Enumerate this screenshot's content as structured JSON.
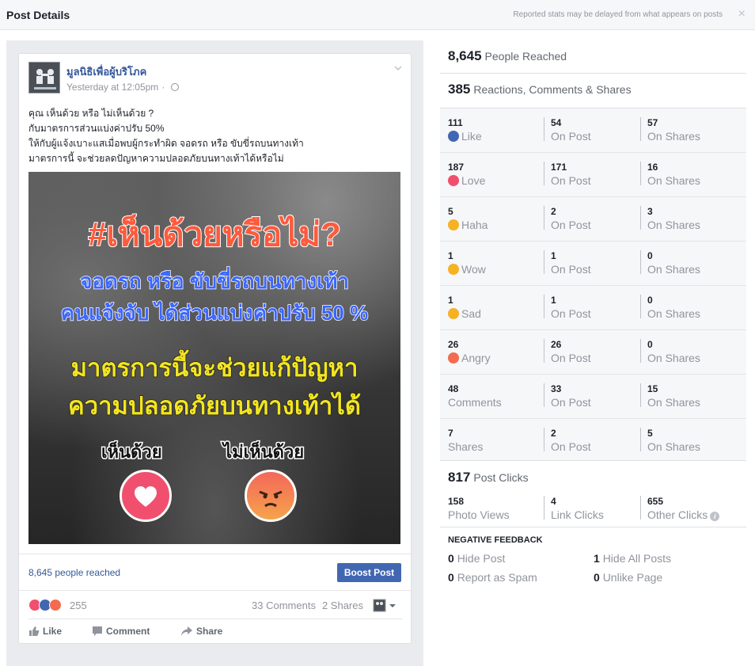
{
  "header": {
    "title": "Post Details",
    "note": "Reported stats may be delayed from what appears on posts",
    "close_icon": "×"
  },
  "post": {
    "page_name": "มูลนิธิเพื่อผู้บริโภค",
    "time": "Yesterday at 12:05pm",
    "time_sep": "·",
    "text_lines": [
      "คุณ เห็นด้วย หรือ ไม่เห็นด้วย ?",
      "กับมาตรการส่วนแบ่งค่าปรับ 50%",
      "ให้กับผู้แจ้งเบาะแสเมื่อพบผู้กระทำผิด จอดรถ หรือ ขับขี่รถบนทางเท้า",
      "มาตรการนี้ จะช่วยลดปัญหาความปลอดภัยบนทางเท้าได้หรือไม่"
    ],
    "image": {
      "line1": "#เห็นด้วยหรือไม่?",
      "line2": "จอดรถ หรือ ขับขี่รถบนทางเท้า",
      "line3": "คนแจ้งจับ ได้ส่วนแบ่งค่าปรับ 50 %",
      "line4": "มาตรการนี้จะช่วยแก้ปัญหา",
      "line5": "ความปลอดภัยบนทางเท้าได้",
      "agree": "เห็นด้วย",
      "disagree": "ไม่เห็นด้วย"
    },
    "reached": "8,645 people reached",
    "boost_label": "Boost Post",
    "reaction_count": "255",
    "comments": "33 Comments",
    "shares": "2 Shares",
    "actions": {
      "like": "Like",
      "comment": "Comment",
      "share": "Share"
    }
  },
  "stats": {
    "people_reached": {
      "num": "8,645",
      "label": "People Reached"
    },
    "engagement": {
      "num": "385",
      "label": "Reactions, Comments & Shares"
    },
    "rows": [
      {
        "total": "111",
        "label": "Like",
        "icon": "like-icon",
        "color": "#4267b2",
        "on_post": "54",
        "on_shares": "57"
      },
      {
        "total": "187",
        "label": "Love",
        "icon": "love-icon",
        "color": "#f0506e",
        "on_post": "171",
        "on_shares": "16"
      },
      {
        "total": "5",
        "label": "Haha",
        "icon": "haha-icon",
        "color": "#f7b125",
        "on_post": "2",
        "on_shares": "3"
      },
      {
        "total": "1",
        "label": "Wow",
        "icon": "wow-icon",
        "color": "#f7b125",
        "on_post": "1",
        "on_shares": "0"
      },
      {
        "total": "1",
        "label": "Sad",
        "icon": "sad-icon",
        "color": "#f7b125",
        "on_post": "1",
        "on_shares": "0"
      },
      {
        "total": "26",
        "label": "Angry",
        "icon": "angry-icon",
        "color": "#f36c4f",
        "on_post": "26",
        "on_shares": "0"
      },
      {
        "total": "48",
        "label": "Comments",
        "icon": "",
        "color": "",
        "on_post": "33",
        "on_shares": "15"
      },
      {
        "total": "7",
        "label": "Shares",
        "icon": "",
        "color": "",
        "on_post": "2",
        "on_shares": "5"
      }
    ],
    "on_post_label": "On Post",
    "on_shares_label": "On Shares",
    "post_clicks": {
      "num": "817",
      "label": "Post Clicks"
    },
    "clicks": [
      {
        "num": "158",
        "label": "Photo Views"
      },
      {
        "num": "4",
        "label": "Link Clicks"
      },
      {
        "num": "655",
        "label": "Other Clicks"
      }
    ],
    "negative": {
      "title": "NEGATIVE FEEDBACK",
      "hide_post": {
        "num": "0",
        "label": "Hide Post"
      },
      "hide_all": {
        "num": "1",
        "label": "Hide All Posts"
      },
      "spam": {
        "num": "0",
        "label": "Report as Spam"
      },
      "unlike": {
        "num": "0",
        "label": "Unlike Page"
      }
    }
  }
}
